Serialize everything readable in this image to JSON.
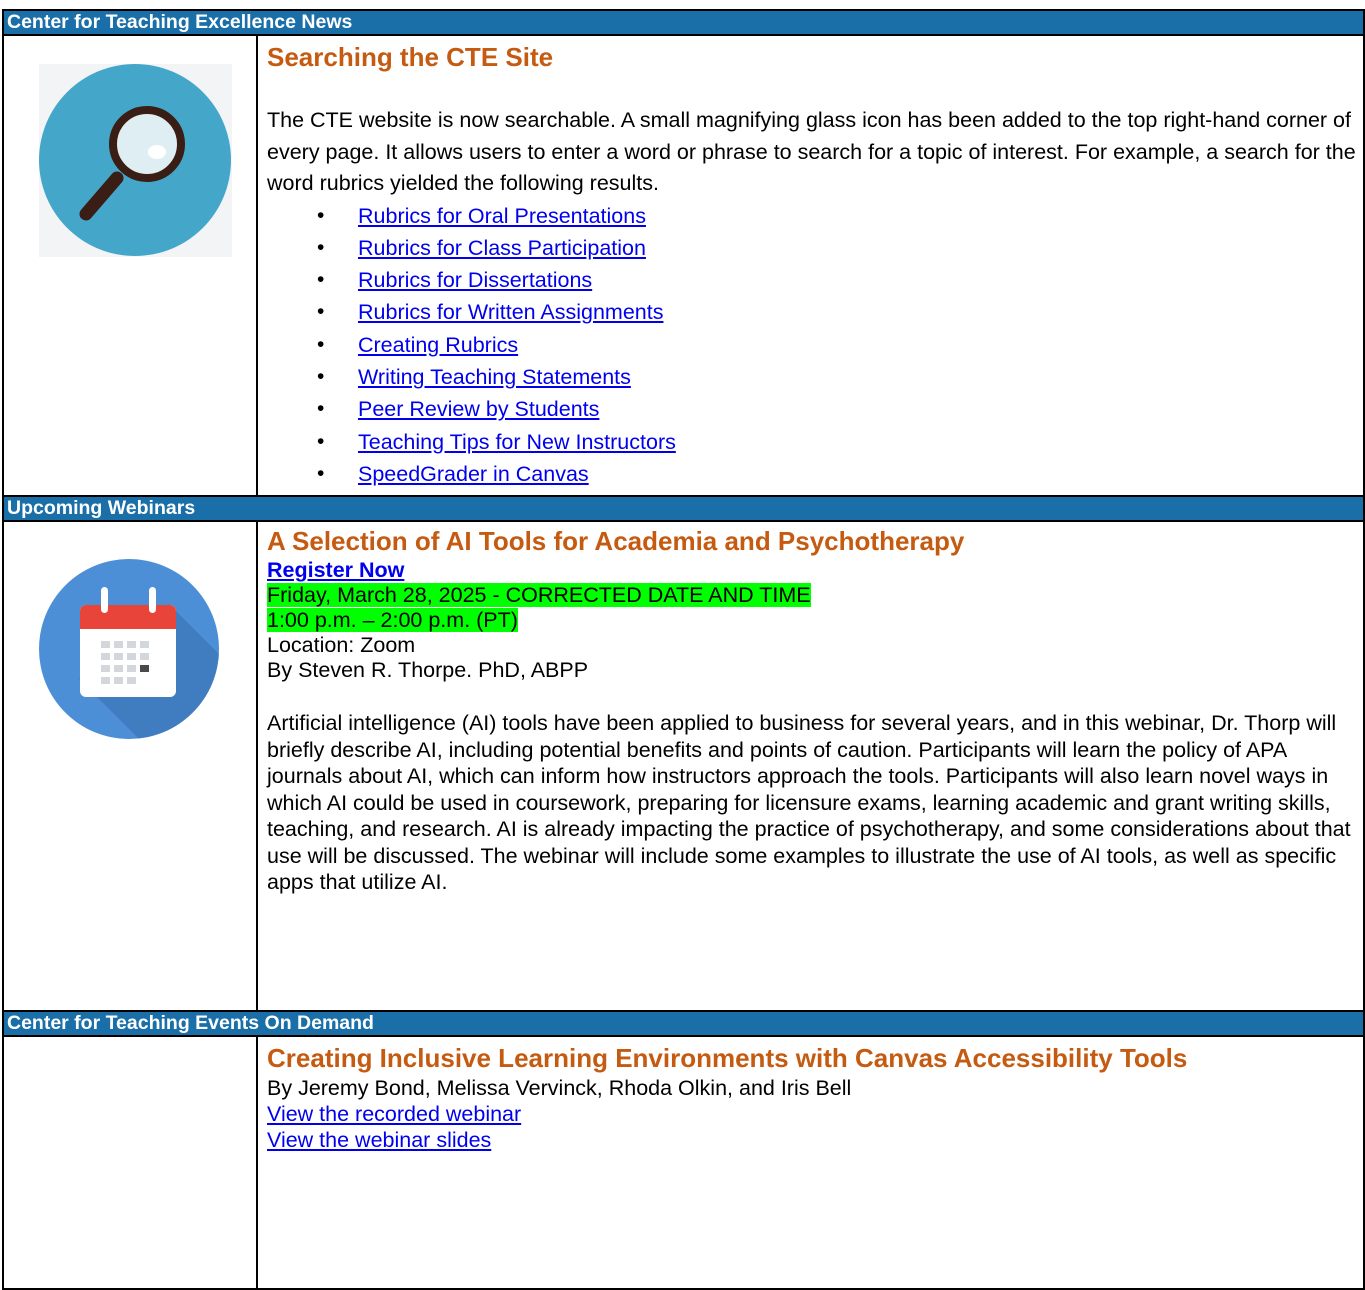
{
  "sections": [
    {
      "header": "Center for Teaching Excellence News",
      "title": "Searching the CTE Site",
      "paragraph": "The CTE website is now searchable. A small magnifying glass icon has been added to the top right-hand corner of every page. It allows users to enter a word or phrase to search for a topic of interest. For example, a search for the word rubrics yielded the following results.",
      "icon": "magnifying-glass-icon",
      "links": [
        "Rubrics for Oral Presentations",
        "Rubrics for Class Participation",
        "Rubrics for Dissertations",
        "Rubrics for Written Assignments",
        "Creating Rubrics",
        "Writing Teaching Statements",
        "Peer Review by Students",
        "Teaching Tips for New Instructors",
        "SpeedGrader in Canvas"
      ]
    },
    {
      "header": "Upcoming Webinars",
      "title": "A Selection of AI Tools for Academia and Psychotherapy",
      "register": "Register Now",
      "date": "Friday, March 28, 2025 - CORRECTED DATE AND TIME",
      "time": "1:00 p.m. – 2:00 p.m. (PT)",
      "location": "Location: Zoom",
      "byline": "By Steven R. Thorpe. PhD, ABPP",
      "icon": "calendar-icon",
      "paragraph": "Artificial intelligence (AI) tools have been applied to business for several years, and in this webinar, Dr. Thorp will briefly describe AI, including potential benefits and points of caution. Participants will learn the policy of APA journals about AI, which can inform how instructors approach the tools. Participants will also learn novel ways in which AI could be used in coursework, preparing for licensure exams, learning academic and grant writing skills, teaching, and research. AI is already impacting the practice of psychotherapy, and some considerations about that use will be discussed. The webinar will include some examples to illustrate the use of AI tools, as well as specific apps that utilize AI."
    },
    {
      "header": "Center for Teaching Events On Demand",
      "title": "Creating Inclusive Learning Environments with Canvas Accessibility Tools",
      "byline": "By Jeremy Bond, Melissa Vervinck, Rhoda Olkin, and Iris Bell",
      "links": [
        "View the recorded webinar",
        "View the webinar slides"
      ]
    }
  ],
  "colors": {
    "header_bg": "#1a6fa8",
    "title": "#c55a11",
    "link": "#0000ee",
    "highlight": "#00ff00"
  }
}
